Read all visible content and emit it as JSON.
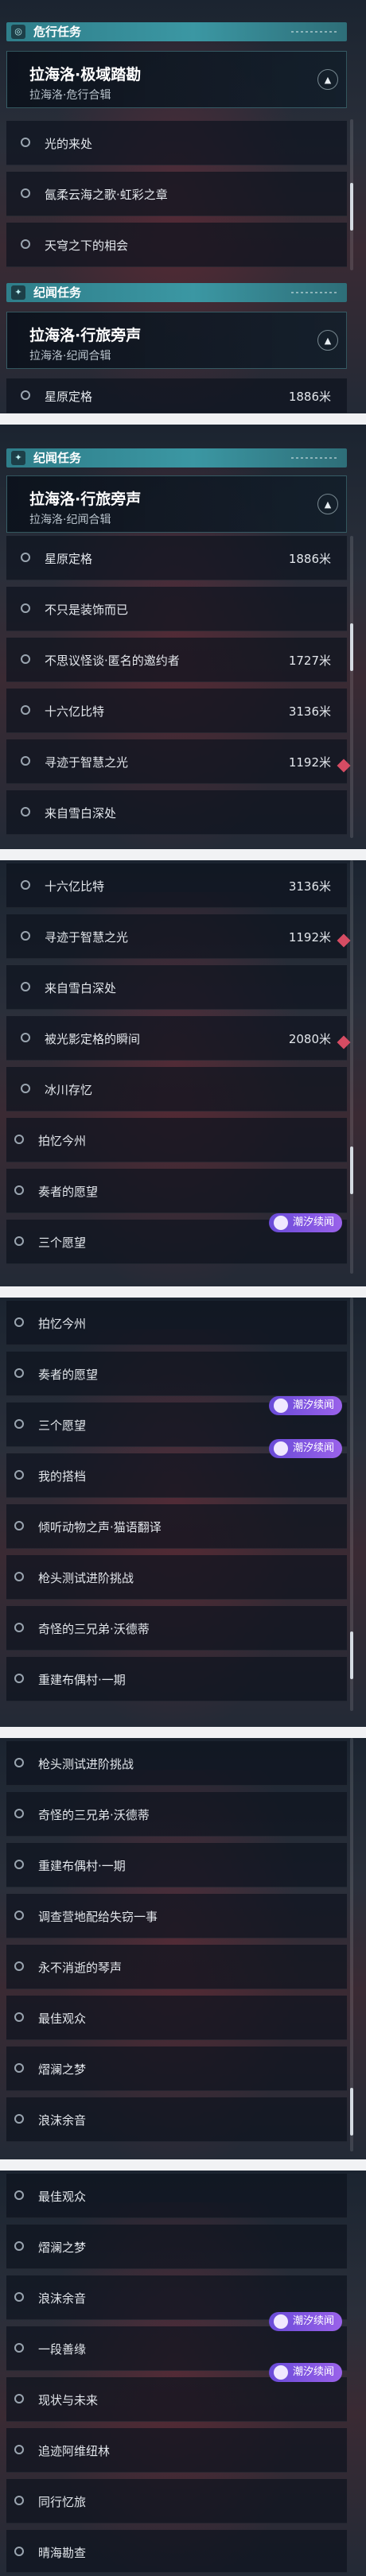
{
  "sections": {
    "legend": "危行任务",
    "world": "纪闻任务"
  },
  "chapters": {
    "legend": {
      "name": "拉海洛·极域踏勘",
      "sub": "拉海洛·危行合辑"
    },
    "world": {
      "name": "拉海洛·行旅旁声",
      "sub": "拉海洛·纪闻合辑"
    }
  },
  "quests": {
    "q1": "光的来处",
    "q2": "氤柔云海之歌·虹彩之章",
    "q3": "天穹之下的相会",
    "q4": "星原定格",
    "q5": "不只是装饰而已",
    "q6": "不思议怪谈·匿名的邀约者",
    "q7": "十六亿比特",
    "q8": "寻迹于智慧之光",
    "q9": "来自雪白深处",
    "q10": "被光影定格的瞬间",
    "q11": "冰川存忆",
    "q12": "拍忆今州",
    "q13": "奏者的愿望",
    "q14": "三个愿望",
    "q15": "我的搭档",
    "q16": "倾听动物之声·猫语翻译",
    "q17": "枪头测试进阶挑战",
    "q18": "奇怪的三兄弟·沃德蒂",
    "q19": "重建布偶村·一期",
    "q20": "调查营地配给失窃一事",
    "q21": "永不消逝的琴声",
    "q22": "最佳观众",
    "q23": "熠澜之梦",
    "q24": "浪沫余音",
    "q25": "一段善缘",
    "q26": "现状与未来",
    "q27": "追迹阿维纽林",
    "q28": "同行忆旅",
    "q29": "晴海勘查"
  },
  "distances": {
    "q4": "1886米",
    "q6": "1727米",
    "q7": "3136米",
    "q8": "1192米",
    "q10": "2080米"
  },
  "tag_label": "潮汐续闻",
  "icons": {
    "legend_section": "compass-icon",
    "world_section": "star-icon",
    "collapse": "chevron-up-icon",
    "quest": "circle-icon",
    "tag": "tide-icon",
    "tracked": "diamond-marker-icon"
  },
  "colors": {
    "section_teal": "#3b97a3",
    "tag_purple": "#8a58e4",
    "marker_red": "#d64c63",
    "separator": "#f1f2f4"
  }
}
